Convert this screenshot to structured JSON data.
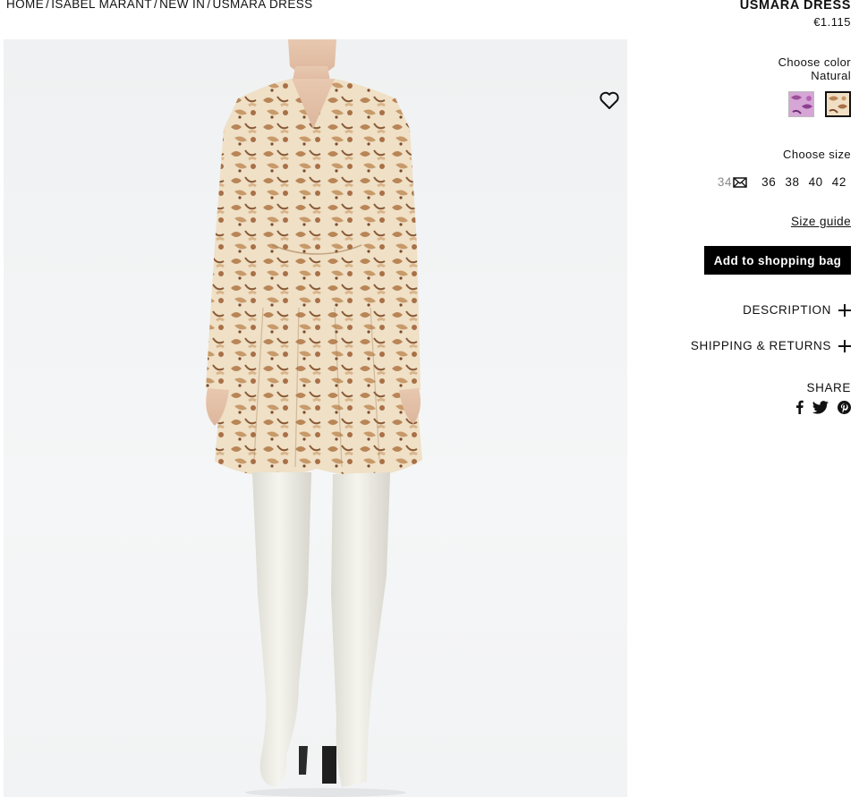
{
  "breadcrumb": {
    "items": [
      "HOME",
      "ISABEL MARANT",
      "NEW IN",
      "USMARA DRESS"
    ],
    "separator": "/"
  },
  "product": {
    "title": "USMARA DRESS",
    "price": "€1.115"
  },
  "color": {
    "label": "Choose color",
    "selected": "Natural",
    "swatches": [
      {
        "name": "pink-print",
        "color": "#b87fb8"
      },
      {
        "name": "natural-print",
        "color": "#d8b892",
        "selected": true
      }
    ]
  },
  "size": {
    "label": "Choose size",
    "options": [
      "34",
      "36",
      "38",
      "40",
      "42"
    ],
    "unavailable": [
      "34"
    ]
  },
  "size_guide": "Size guide",
  "add_to_bag": "Add to shopping bag",
  "accordions": {
    "description": "DESCRIPTION",
    "shipping": "SHIPPING & RETURNS"
  },
  "share": {
    "label": "SHARE",
    "icons": [
      "facebook-icon",
      "twitter-icon",
      "pinterest-icon"
    ]
  },
  "icons": {
    "wishlist": "heart-icon",
    "notify": "envelope-icon"
  },
  "colors": {
    "button_bg": "#000000",
    "text": "#111111",
    "unavailable": "#888888",
    "dress_base": "#efe0c6",
    "dress_print": "#b98556",
    "boots": "#ecebe3",
    "heel": "#1e1e1e"
  }
}
